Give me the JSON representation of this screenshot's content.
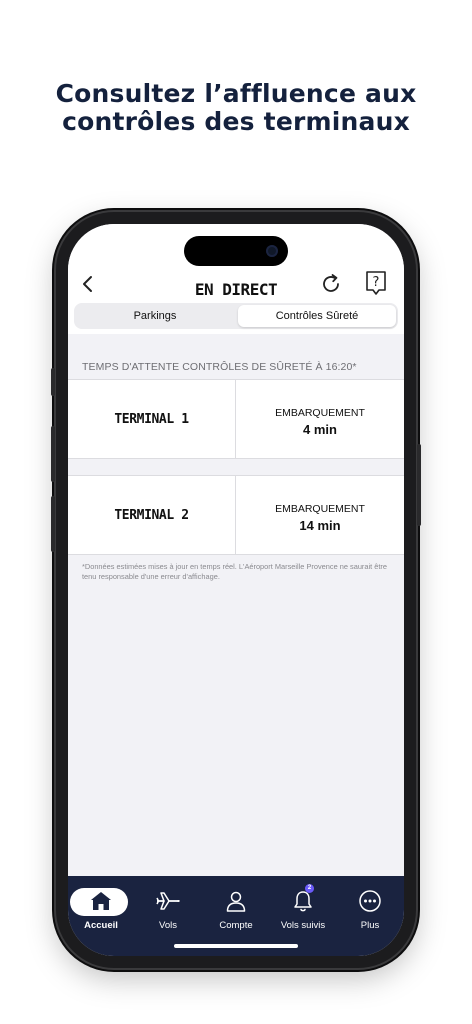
{
  "headline": {
    "line1": "Consultez l’affluence aux",
    "line2": "contrôles des terminaux"
  },
  "appbar": {
    "title": "EN DIRECT",
    "back_icon": "chevron-left-icon",
    "refresh_icon": "refresh-icon",
    "help_icon": "help-bubble-icon",
    "help_glyph": "?"
  },
  "segments": {
    "left_label": "Parkings",
    "right_label": "Contrôles Sûreté",
    "selected": "Contrôles Sûreté"
  },
  "section_label": "TEMPS D'ATTENTE CONTRÔLES DE SÛRETÉ À 16:20*",
  "terminals": [
    {
      "name": "TERMINAL 1",
      "wait_label": "EMBARQUEMENT",
      "wait_value": "4 min"
    },
    {
      "name": "TERMINAL 2",
      "wait_label": "EMBARQUEMENT",
      "wait_value": "14 min"
    }
  ],
  "footnote": "*Données estimées mises à jour en temps réel. L'Aéroport Marseille Provence ne saurait être tenu responsable d'une erreur d'affichage.",
  "tabbar": {
    "tabs": [
      {
        "label": "Accueil",
        "icon": "home-icon",
        "active": true
      },
      {
        "label": "Vols",
        "icon": "plane-icon"
      },
      {
        "label": "Compte",
        "icon": "user-icon"
      },
      {
        "label": "Vols suivis",
        "icon": "bell-icon",
        "badge": "2"
      },
      {
        "label": "Plus",
        "icon": "more-icon"
      }
    ]
  },
  "colors": {
    "headline": "#14213d",
    "tabbar_bg": "#1a2340",
    "badge": "#6a5af9",
    "screen_bg": "#f2f2f6"
  }
}
